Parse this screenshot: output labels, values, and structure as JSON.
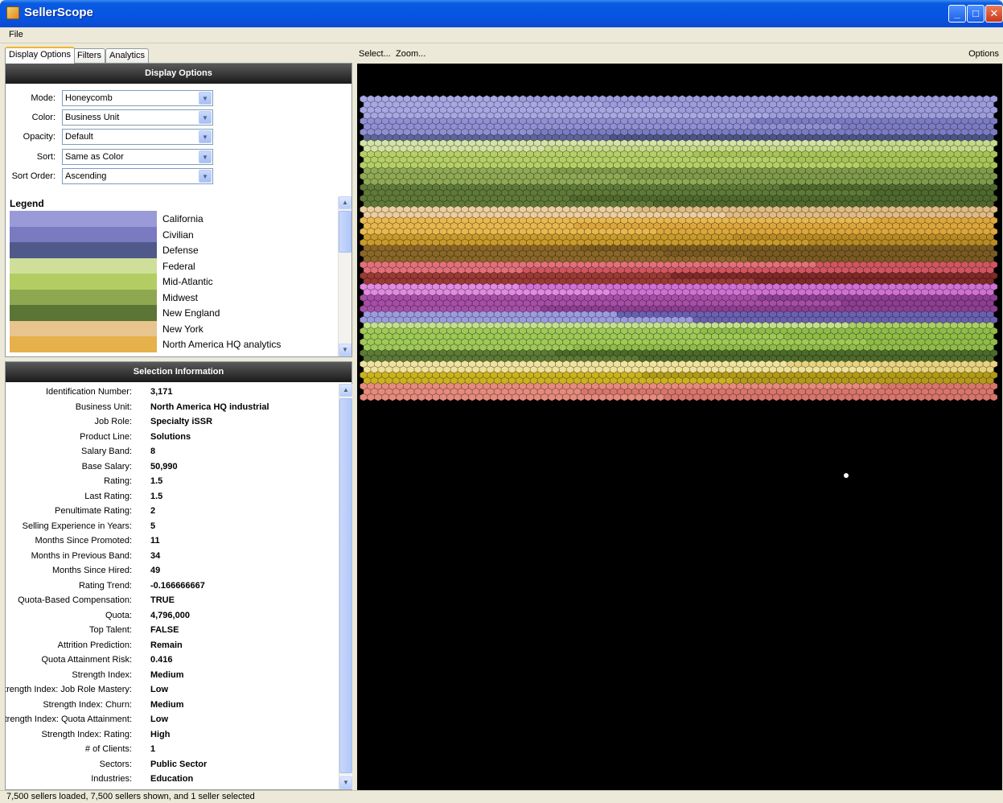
{
  "window": {
    "title": "SellerScope"
  },
  "menu": {
    "file": "File"
  },
  "tabs": {
    "display": "Display Options",
    "filters": "Filters",
    "analytics": "Analytics"
  },
  "display_options": {
    "header": "Display Options",
    "mode": {
      "label": "Mode:",
      "value": "Honeycomb"
    },
    "color": {
      "label": "Color:",
      "value": "Business Unit"
    },
    "opacity": {
      "label": "Opacity:",
      "value": "Default"
    },
    "sort": {
      "label": "Sort:",
      "value": "Same as Color"
    },
    "sort_order": {
      "label": "Sort Order:",
      "value": "Ascending"
    }
  },
  "legend": {
    "title": "Legend",
    "items": [
      {
        "label": "California",
        "color": "#9a9ad8"
      },
      {
        "label": "Civilian",
        "color": "#7a7ac0"
      },
      {
        "label": "Defense",
        "color": "#4f5a8a"
      },
      {
        "label": "Federal",
        "color": "#cfdf9a"
      },
      {
        "label": "Mid-Atlantic",
        "color": "#b3cd63"
      },
      {
        "label": "Midwest",
        "color": "#8ea851"
      },
      {
        "label": "New England",
        "color": "#5b7536"
      },
      {
        "label": "New York",
        "color": "#e8c48e"
      },
      {
        "label": "North America HQ analytics",
        "color": "#e6b04a"
      }
    ]
  },
  "selection": {
    "header": "Selection Information",
    "rows": [
      {
        "label": "Identification Number:",
        "value": "3,171"
      },
      {
        "label": "Business Unit:",
        "value": "North America HQ industrial"
      },
      {
        "label": "Job Role:",
        "value": "Specialty iSSR"
      },
      {
        "label": "Product Line:",
        "value": "Solutions"
      },
      {
        "label": "Salary Band:",
        "value": "8"
      },
      {
        "label": "Base Salary:",
        "value": "50,990"
      },
      {
        "label": "Rating:",
        "value": "1.5"
      },
      {
        "label": "Last Rating:",
        "value": "1.5"
      },
      {
        "label": "Penultimate Rating:",
        "value": "2"
      },
      {
        "label": "Selling Experience in Years:",
        "value": "5"
      },
      {
        "label": "Months Since Promoted:",
        "value": "11"
      },
      {
        "label": "Months in Previous Band:",
        "value": "34"
      },
      {
        "label": "Months Since Hired:",
        "value": "49"
      },
      {
        "label": "Rating Trend:",
        "value": "-0.166666667"
      },
      {
        "label": "Quota-Based Compensation:",
        "value": "TRUE"
      },
      {
        "label": "Quota:",
        "value": "4,796,000"
      },
      {
        "label": "Top Talent:",
        "value": "FALSE"
      },
      {
        "label": "Attrition Prediction:",
        "value": "Remain"
      },
      {
        "label": "Quota Attainment Risk:",
        "value": "0.416"
      },
      {
        "label": "Strength Index:",
        "value": "Medium"
      },
      {
        "label": "Strength Index: Job Role Mastery:",
        "value": "Low"
      },
      {
        "label": "Strength Index: Churn:",
        "value": "Medium"
      },
      {
        "label": "Strength Index: Quota Attainment:",
        "value": "Low"
      },
      {
        "label": "Strength Index: Rating:",
        "value": "High"
      },
      {
        "label": "# of Clients:",
        "value": "1"
      },
      {
        "label": "Sectors:",
        "value": "Public Sector"
      },
      {
        "label": "Industries:",
        "value": "Education"
      }
    ]
  },
  "toolbar": {
    "select": "Select...",
    "zoom": "Zoom...",
    "options": "Options"
  },
  "status": "7,500 sellers loaded, 7,500 sellers shown, and 1 seller selected",
  "honeycomb_bands": [
    {
      "colors": [
        "#a7a7e3",
        "#9c9cdc"
      ],
      "rows": 4
    },
    {
      "colors": [
        "#8f8fd2",
        "#7b7bc2"
      ],
      "rows": 3
    },
    {
      "colors": [
        "#5c6698",
        "#4a5585"
      ],
      "rows": 1
    },
    {
      "colors": [
        "#d4e2a5",
        "#c6d98a"
      ],
      "rows": 2
    },
    {
      "colors": [
        "#b5cf66",
        "#a7c457"
      ],
      "rows": 3
    },
    {
      "colors": [
        "#8fa955",
        "#7f9a4a"
      ],
      "rows": 3
    },
    {
      "colors": [
        "#5f7a38",
        "#4f682e"
      ],
      "rows": 4
    },
    {
      "colors": [
        "#ebcd9e",
        "#dfba82"
      ],
      "rows": 2
    },
    {
      "colors": [
        "#e8b84f",
        "#dca63c"
      ],
      "rows": 3
    },
    {
      "colors": [
        "#c89a2c",
        "#b78a24"
      ],
      "rows": 2
    },
    {
      "colors": [
        "#8a6628",
        "#795a22"
      ],
      "rows": 3
    },
    {
      "colors": [
        "#e2707a",
        "#cf5560"
      ],
      "rows": 2
    },
    {
      "colors": [
        "#9a3a34",
        "#7e2a28"
      ],
      "rows": 2
    },
    {
      "colors": [
        "#e08ae0",
        "#cf70d2"
      ],
      "rows": 2
    },
    {
      "colors": [
        "#a64ea6",
        "#8d3e90"
      ],
      "rows": 3
    },
    {
      "colors": [
        "#9b9bdf",
        "#6a60b0"
      ],
      "rows": 2
    },
    {
      "colors": [
        "#c2e08a",
        "#a7cf63"
      ],
      "rows": 1
    },
    {
      "colors": [
        "#9ec957",
        "#8fbb48"
      ],
      "rows": 4
    },
    {
      "colors": [
        "#5d7a36",
        "#4c6a2b"
      ],
      "rows": 2
    },
    {
      "colors": [
        "#f0e29c",
        "#e8d27e"
      ],
      "rows": 2
    },
    {
      "colors": [
        "#c9b21e",
        "#b09a18"
      ],
      "rows": 2
    },
    {
      "colors": [
        "#e58a7c",
        "#d8756a"
      ],
      "rows": 3
    }
  ]
}
